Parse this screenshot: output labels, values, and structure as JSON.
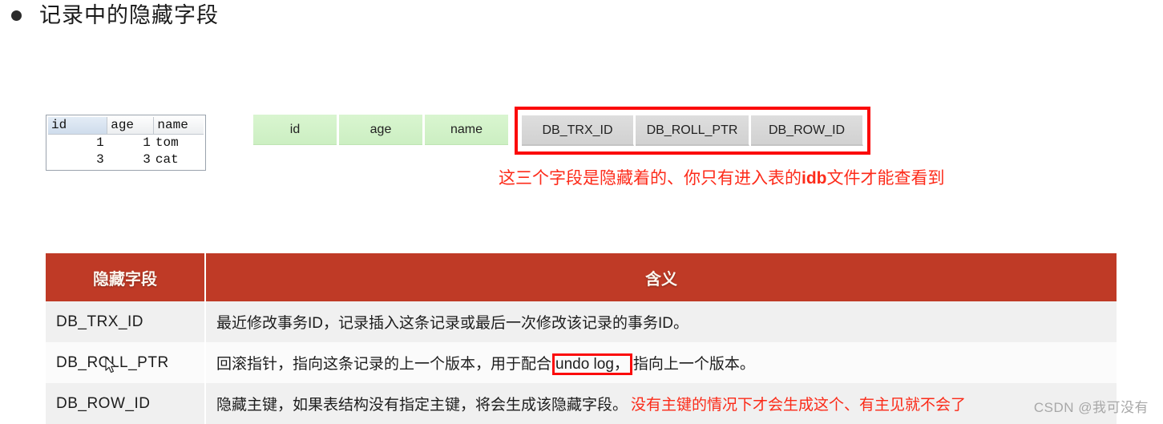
{
  "heading": {
    "bullet_icon": "bullet-dot-icon",
    "text": "记录中的隐藏字段"
  },
  "result_grid": {
    "columns": [
      "id",
      "age",
      "name"
    ],
    "selected_column": "id",
    "rows": [
      {
        "id": "1",
        "age": "1",
        "name": "tom"
      },
      {
        "id": "3",
        "age": "3",
        "name": "cat"
      }
    ]
  },
  "row_layout": {
    "visible_columns": [
      "id",
      "age",
      "name"
    ],
    "hidden_columns": [
      "DB_TRX_ID",
      "DB_ROLL_PTR",
      "DB_ROW_ID"
    ],
    "highlight_color": "#fb0a0a",
    "visible_color": "#d4f1ca",
    "hidden_color": "#d7d7d7"
  },
  "annotation": {
    "hidden_fields_note_part1": "这三个字段是隐藏着的、你只有进入表的",
    "hidden_fields_note_emph": "idb",
    "hidden_fields_note_part2": "文件才能查看到",
    "color": "#fd2b1a"
  },
  "meaning_table": {
    "headers": {
      "field": "隐藏字段",
      "meaning": "含义"
    },
    "header_color": "#bf3a26",
    "rows": [
      {
        "field": "DB_TRX_ID",
        "meaning": "最近修改事务ID，记录插入这条记录或最后一次修改该记录的事务ID。"
      },
      {
        "field": "DB_ROLL_PTR",
        "meaning_prefix": "回滚指针，指向这条记录的上一个版本，用于配合",
        "meaning_boxed": "undo log，",
        "meaning_suffix": "指向上一个版本。"
      },
      {
        "field": "DB_ROW_ID",
        "meaning": "隐藏主键，如果表结构没有指定主键，将会生成该隐藏字段。",
        "red_note": "没有主键的情况下才会生成这个、有主见就不会了"
      }
    ]
  },
  "watermark": {
    "text": "CSDN @我可没有"
  }
}
